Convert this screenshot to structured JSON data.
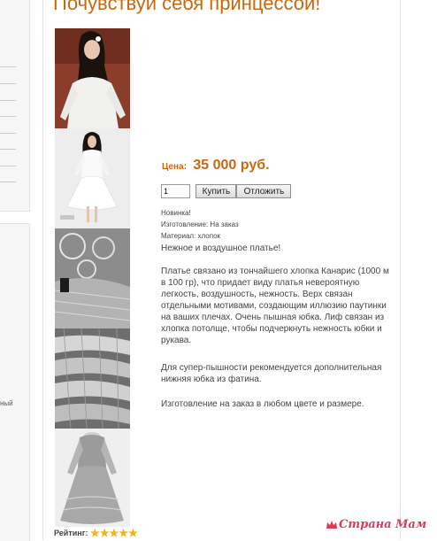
{
  "page": {
    "title": "Почувствуй себя принцессой!"
  },
  "sidebar": {
    "fragment_text": "ный"
  },
  "product": {
    "price_label": "Цена:",
    "price_value": "35 000 руб.",
    "quantity_value": "1",
    "buy_label": "Купить",
    "defer_label": "Отложить",
    "meta": {
      "badge": "Новинка!",
      "production": "Изготовление: На заказ",
      "material": "Материал: хлопок"
    },
    "description": [
      "Нежное и воздушное платье!",
      "Платье связано из тончайшего хлопка Канарис (1000 м в 100 гр), что придает виду платья невероятную легкость, воздушность, нежность. Верх связан отдельными мотивами, создающим иллюзию паутинки на ваших плечах. Очень пышная юбка. Лиф связан из хлопка потолще, чтобы подчеркнуть нежность юбки и рукава.",
      "Для супер-пышности рекомендуется дополнительная нижняя юбка из фатина.",
      "Изготовление на заказ в любом цвете и размере."
    ]
  },
  "gallery": {
    "thumbnails": [
      {
        "name": "photo-model-upper"
      },
      {
        "name": "photo-model-full"
      },
      {
        "name": "photo-lace-detail"
      },
      {
        "name": "photo-skirt-detail"
      },
      {
        "name": "photo-dress-mannequin"
      }
    ]
  },
  "rating": {
    "label": "Рейтинг:",
    "stars": 5,
    "stars_text": "★★★★★"
  },
  "watermark": {
    "text": "Страна Мам"
  },
  "colors": {
    "accent": "#c8680f",
    "star": "#f2b21b",
    "watermark": "#d93c5b"
  }
}
